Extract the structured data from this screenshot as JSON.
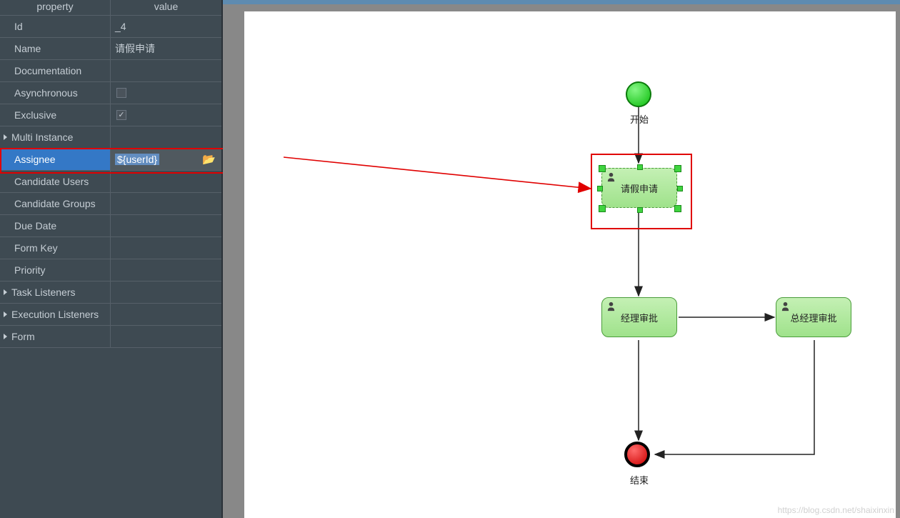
{
  "props_panel": {
    "header_property": "property",
    "header_value": "value",
    "rows": [
      {
        "name": "Id",
        "value": "_4",
        "expandable": false
      },
      {
        "name": "Name",
        "value": "请假申请",
        "expandable": false
      },
      {
        "name": "Documentation",
        "value": "",
        "expandable": false
      },
      {
        "name": "Asynchronous",
        "value": "",
        "checkbox": "unchecked",
        "expandable": false
      },
      {
        "name": "Exclusive",
        "value": "",
        "checkbox": "checked",
        "expandable": false
      },
      {
        "name": "Multi Instance",
        "value": "",
        "expandable": true
      },
      {
        "name": "Assignee",
        "value": "${userId}",
        "expandable": false,
        "selected": true,
        "has_browse": true
      },
      {
        "name": "Candidate Users",
        "value": "",
        "expandable": false
      },
      {
        "name": "Candidate Groups",
        "value": "",
        "expandable": false
      },
      {
        "name": "Due Date",
        "value": "",
        "expandable": false
      },
      {
        "name": "Form Key",
        "value": "",
        "expandable": false
      },
      {
        "name": "Priority",
        "value": "",
        "expandable": false
      },
      {
        "name": "Task Listeners",
        "value": "",
        "expandable": true
      },
      {
        "name": "Execution Listeners",
        "value": "",
        "expandable": true
      },
      {
        "name": "Form",
        "value": "",
        "expandable": true
      }
    ]
  },
  "diagram": {
    "start_label": "开始",
    "task1_label": "请假申请",
    "task2_label": "经理审批",
    "task3_label": "总经理审批",
    "end_label": "结束"
  },
  "watermark": "https://blog.csdn.net/shaixinxin"
}
